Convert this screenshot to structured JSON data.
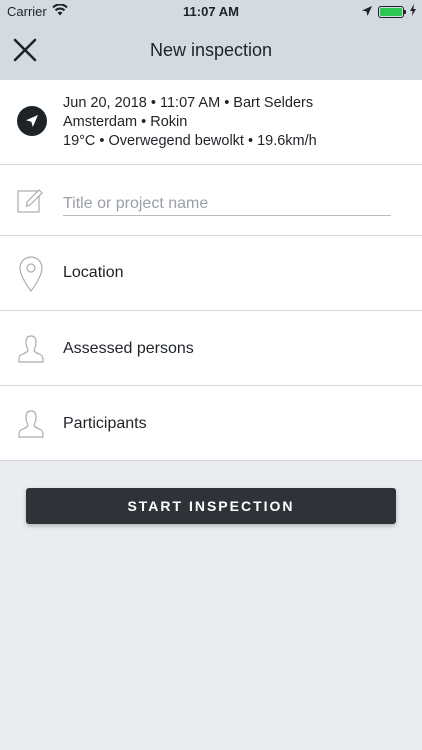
{
  "status_bar": {
    "carrier": "Carrier",
    "time": "11:07 AM",
    "battery_level": 1.0,
    "icons": [
      "wifi-icon",
      "location-arrow-icon",
      "battery-icon",
      "charging-bolt-icon"
    ]
  },
  "nav": {
    "title": "New inspection",
    "close_icon": "close-icon"
  },
  "info": {
    "line1": "Jun 20, 2018 • 11:07 AM • Bart Selders",
    "line2": "Amsterdam • Rokin",
    "line3": "19°C • Overwegend bewolkt • 19.6km/h",
    "icon": "navigation-arrow-icon"
  },
  "form": {
    "title_placeholder": "Title or project name",
    "title_value": "",
    "location_label": "Location",
    "assessed_label": "Assessed persons",
    "participants_label": "Participants"
  },
  "actions": {
    "start_label": "START INSPECTION"
  },
  "colors": {
    "header_bg": "#d4dbe0",
    "page_bg": "#e9edf0",
    "button_bg": "#2d3338",
    "battery": "#2dc653"
  }
}
